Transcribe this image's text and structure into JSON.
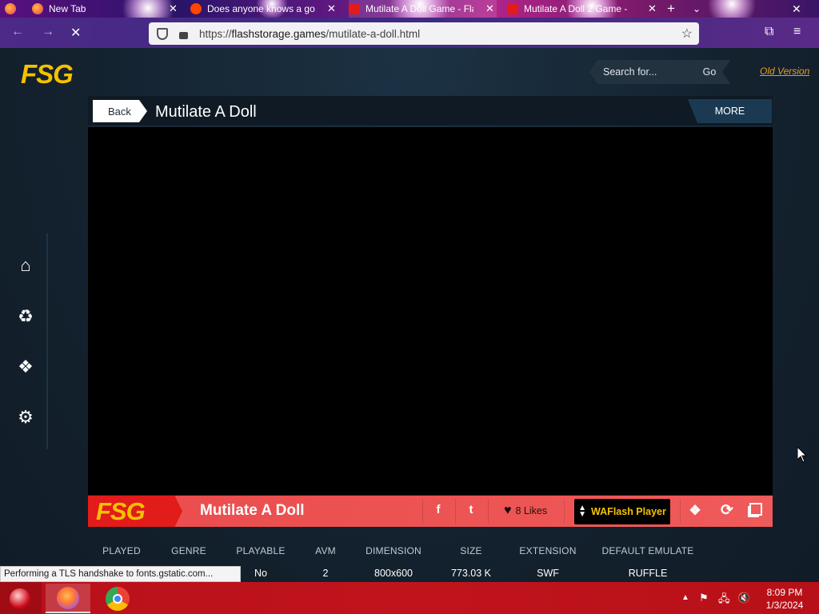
{
  "browser": {
    "tabs": [
      {
        "title": "New Tab",
        "icon": "firefox-icon"
      },
      {
        "title": "Does anyone knows a go",
        "icon": "reddit-icon"
      },
      {
        "title": "Mutilate A Doll Game - Fla",
        "icon": "fsg-icon"
      },
      {
        "title": "Mutilate A Doll 2 Game -",
        "icon": "fsg-icon"
      }
    ],
    "url_prefix": "https://",
    "url_host": "flashstorage.games",
    "url_path": "/mutilate-a-doll.html",
    "status_text": "Performing a TLS handshake to fonts.gstatic.com..."
  },
  "site": {
    "logo": "FSG",
    "search_placeholder": "Search for...",
    "search_button": "Go",
    "old_version": "Old Version",
    "sidebar": [
      "home-icon",
      "recycle-icon",
      "grid-icon",
      "settings-icon"
    ]
  },
  "game": {
    "back_label": "Back",
    "title": "Mutilate A Doll",
    "more_label": "MORE",
    "bar_logo": "FSG",
    "bar_title": "Mutilate A Doll",
    "likes": "8 Likes",
    "player_button": "WAFlash Player"
  },
  "stats": {
    "headers": [
      "PLAYED",
      "GENRE",
      "PLAYABLE",
      "AVM",
      "DIMENSION",
      "SIZE",
      "EXTENSION",
      "DEFAULT EMULATE"
    ],
    "values": [
      "",
      "",
      "No",
      "2",
      "800x600",
      "773.03 K",
      "SWF",
      "RUFFLE"
    ]
  },
  "taskbar": {
    "time": "8:09 PM",
    "date": "1/3/2024"
  },
  "colors": {
    "accent_yellow": "#f5c200",
    "bar_red": "#ea4c4c",
    "page_bg": "#142230",
    "link_orange": "#e8a020"
  }
}
